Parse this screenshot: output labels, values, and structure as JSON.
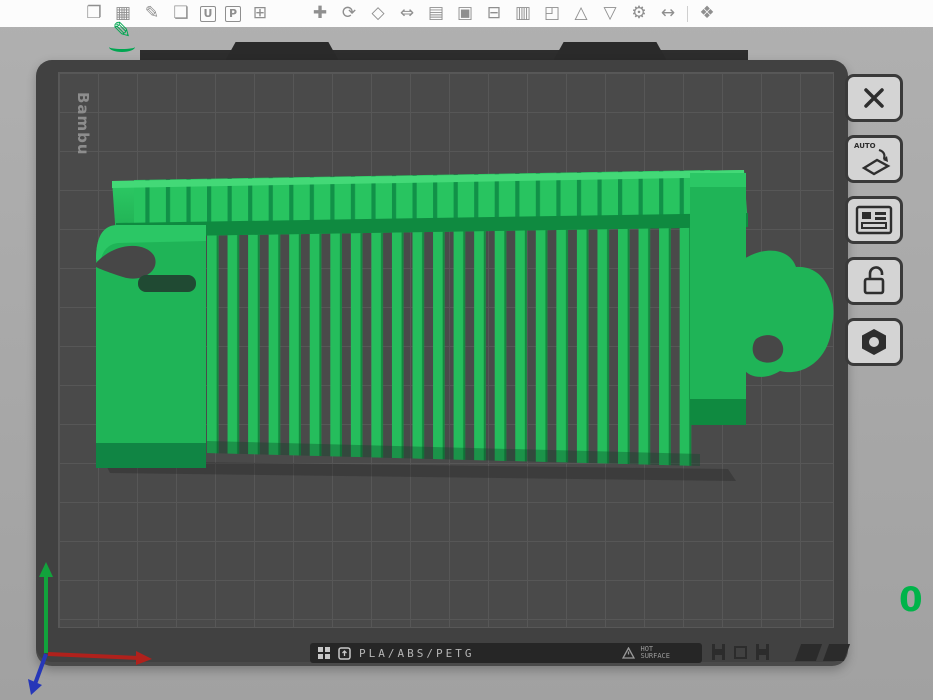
{
  "window": {
    "viewport_background": "#a8a8a8",
    "topbar_background": "#fcfcfc"
  },
  "toolbar": {
    "icons": [
      {
        "glyph": "❐"
      },
      {
        "glyph": "▦"
      },
      {
        "glyph": "✎"
      },
      {
        "glyph": "❏"
      },
      {
        "glyph": "U"
      },
      {
        "glyph": "P"
      },
      {
        "glyph": "⊞"
      },
      {
        "glyph": "✚"
      },
      {
        "glyph": "⟳"
      },
      {
        "glyph": "◇"
      },
      {
        "glyph": "⇔"
      },
      {
        "glyph": "▤"
      },
      {
        "glyph": "▣"
      },
      {
        "glyph": "⊟"
      },
      {
        "glyph": "▥"
      },
      {
        "glyph": "◰"
      },
      {
        "glyph": "△"
      },
      {
        "glyph": "▽"
      },
      {
        "glyph": "⚙"
      },
      {
        "glyph": "↔"
      },
      {
        "glyph": "❖"
      }
    ]
  },
  "active_tool": {
    "glyph": "✎"
  },
  "plate": {
    "brand": "Bambu",
    "bar": {
      "materials": "PLA/ABS/PETG",
      "warning_top": "HOT",
      "warning_bottom": "SURFACE"
    }
  },
  "side_toolbar": {
    "auto_label": "AUTO"
  },
  "overlay": {
    "value": "0"
  },
  "model": {
    "color": "#25bd5c",
    "description": "green comb-shaped part on build plate"
  }
}
